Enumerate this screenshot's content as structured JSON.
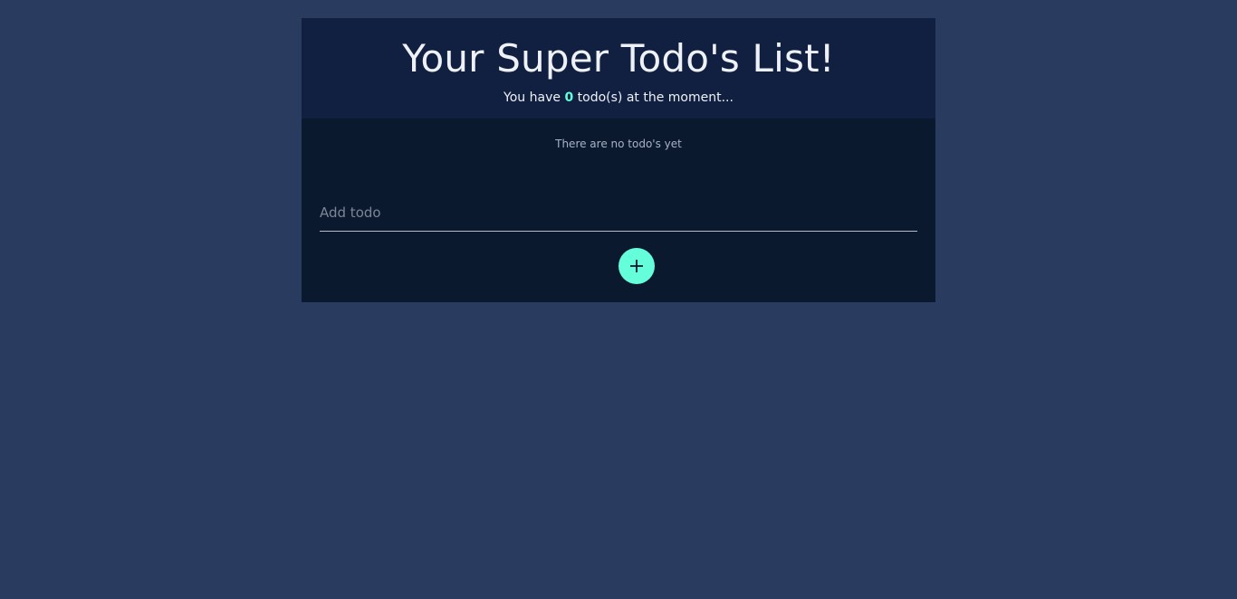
{
  "header": {
    "title": "Your Super Todo's List!",
    "subtitle_prefix": "You have ",
    "todo_count": "0",
    "subtitle_suffix": " todo(s) at the moment..."
  },
  "list": {
    "empty_message": "There are no todo's yet"
  },
  "form": {
    "input_placeholder": "Add todo",
    "input_value": "",
    "add_button_icon": "plus-icon"
  },
  "colors": {
    "page_background": "#293b5f",
    "header_background": "#112041",
    "body_background": "#0b192f",
    "accent": "#64ffda"
  }
}
